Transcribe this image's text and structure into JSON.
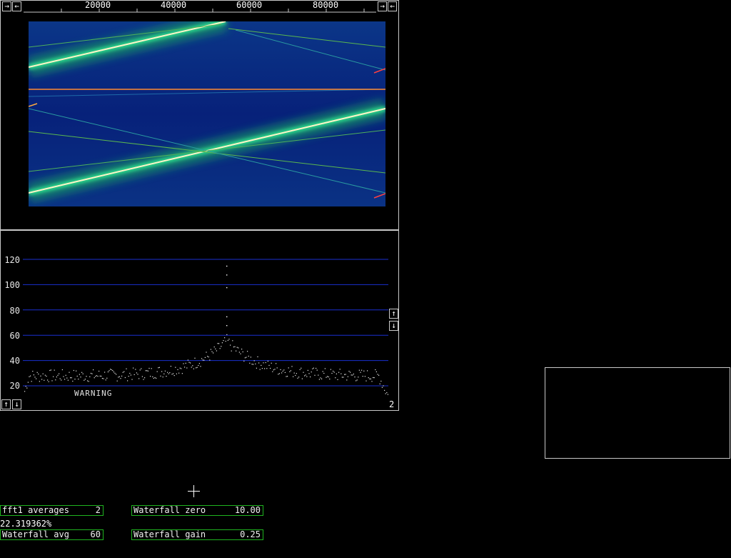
{
  "waterfall": {
    "freq_ticks": [
      "20000",
      "40000",
      "60000",
      "80000"
    ],
    "buttons": {
      "scroll_right_left": "→",
      "scroll_left_left": "←",
      "scroll_right_right": "→",
      "scroll_left_right": "←"
    }
  },
  "spectrum": {
    "y_ticks": [
      "120",
      "100",
      "80",
      "60",
      "40",
      "20"
    ],
    "warning": "WARNING",
    "channel": "2",
    "buttons": {
      "right_up": "↑",
      "right_down": "↓",
      "left_up": "↑",
      "left_down": "↓"
    },
    "chart_data": {
      "type": "scatter",
      "ylim": [
        0,
        130
      ],
      "peak_value": 115,
      "baseline": 28
    }
  },
  "params": {
    "fft_averages": {
      "label": "fft1 averages",
      "value": "2"
    },
    "waterfall_avg": {
      "label": "Waterfall avg",
      "value": "60"
    },
    "waterfall_zero": {
      "label": "Waterfall zero",
      "value": "10.00"
    },
    "waterfall_gain": {
      "label": "Waterfall gain",
      "value": "0.25"
    }
  },
  "status": {
    "percent": "22.319362%"
  },
  "colors": {
    "frame": "#c8c8c8",
    "param_border": "#1fb31f",
    "grid": "#1a2fd0"
  }
}
